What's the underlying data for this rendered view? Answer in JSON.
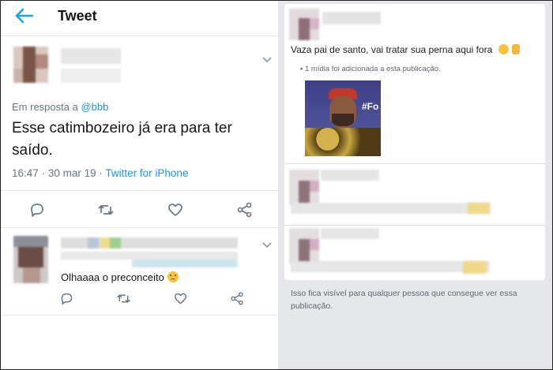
{
  "left": {
    "topbar": {
      "title": "Tweet"
    },
    "tweet": {
      "reply_prefix": "Em resposta a",
      "reply_handle": "@bbb",
      "text_line1": "Esse catimbozeiro já era para ter",
      "text_line2": "saído.",
      "time": "16:47",
      "sep": "·",
      "date": "30 mar 19",
      "via": "Twitter for iPhone"
    },
    "reply": {
      "text": "Olhaaaa o preconceito"
    }
  },
  "right": {
    "post_text": "Vaza pai de santo, vai tratar sua perna aqui fora",
    "media_note": "▪ 1 mídia foi adicionada a esta publicação.",
    "meme_caption": "#Fo",
    "footer_line1": "Isso fica visível para qualquer pessoa que consegue ver essa",
    "footer_line2": "publicação."
  },
  "colors": {
    "twitter_blue": "#1b95e0",
    "text_dark": "#14171a",
    "text_gray": "#657786",
    "right_bg": "#e6e7ea"
  },
  "icons": [
    "back-arrow-icon",
    "chevron-down-icon",
    "reply-icon",
    "retweet-icon",
    "like-icon",
    "share-icon"
  ]
}
